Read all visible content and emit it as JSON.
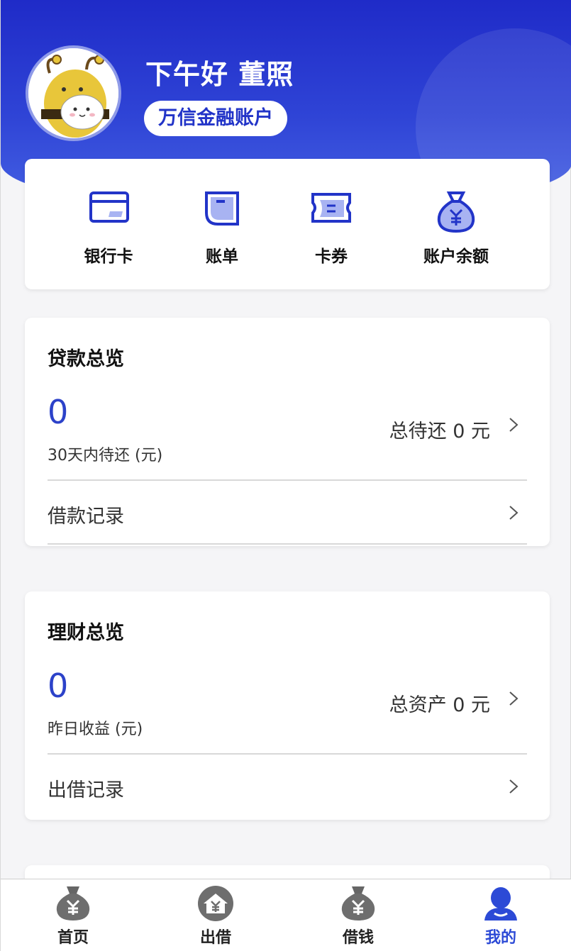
{
  "header": {
    "greeting": "下午好 董照",
    "account_label": "万信金融账户"
  },
  "quick_actions": [
    {
      "label": "银行卡",
      "icon": "bank-card-icon"
    },
    {
      "label": "账单",
      "icon": "bill-icon"
    },
    {
      "label": "卡券",
      "icon": "coupon-icon"
    },
    {
      "label": "账户余额",
      "icon": "money-bag-icon"
    }
  ],
  "loan_overview": {
    "title": "贷款总览",
    "amount": "0",
    "amount_label": "30天内待还 (元)",
    "total_label": "总待还 0 元",
    "record_label": "借款记录"
  },
  "finance_overview": {
    "title": "理财总览",
    "amount": "0",
    "amount_label": "昨日收益 (元)",
    "total_label": "总资产 0 元",
    "record_label": "出借记录"
  },
  "tabbar": [
    {
      "label": "首页",
      "icon": "money-bag-icon"
    },
    {
      "label": "出借",
      "icon": "house-money-icon"
    },
    {
      "label": "借钱",
      "icon": "money-bag-icon"
    },
    {
      "label": "我的",
      "icon": "user-icon",
      "active": true
    }
  ],
  "colors": {
    "primary": "#2234c8",
    "accent": "#2c42c9",
    "tab_active": "#2c4ad6",
    "icon_fill": "#a8b3f2"
  }
}
